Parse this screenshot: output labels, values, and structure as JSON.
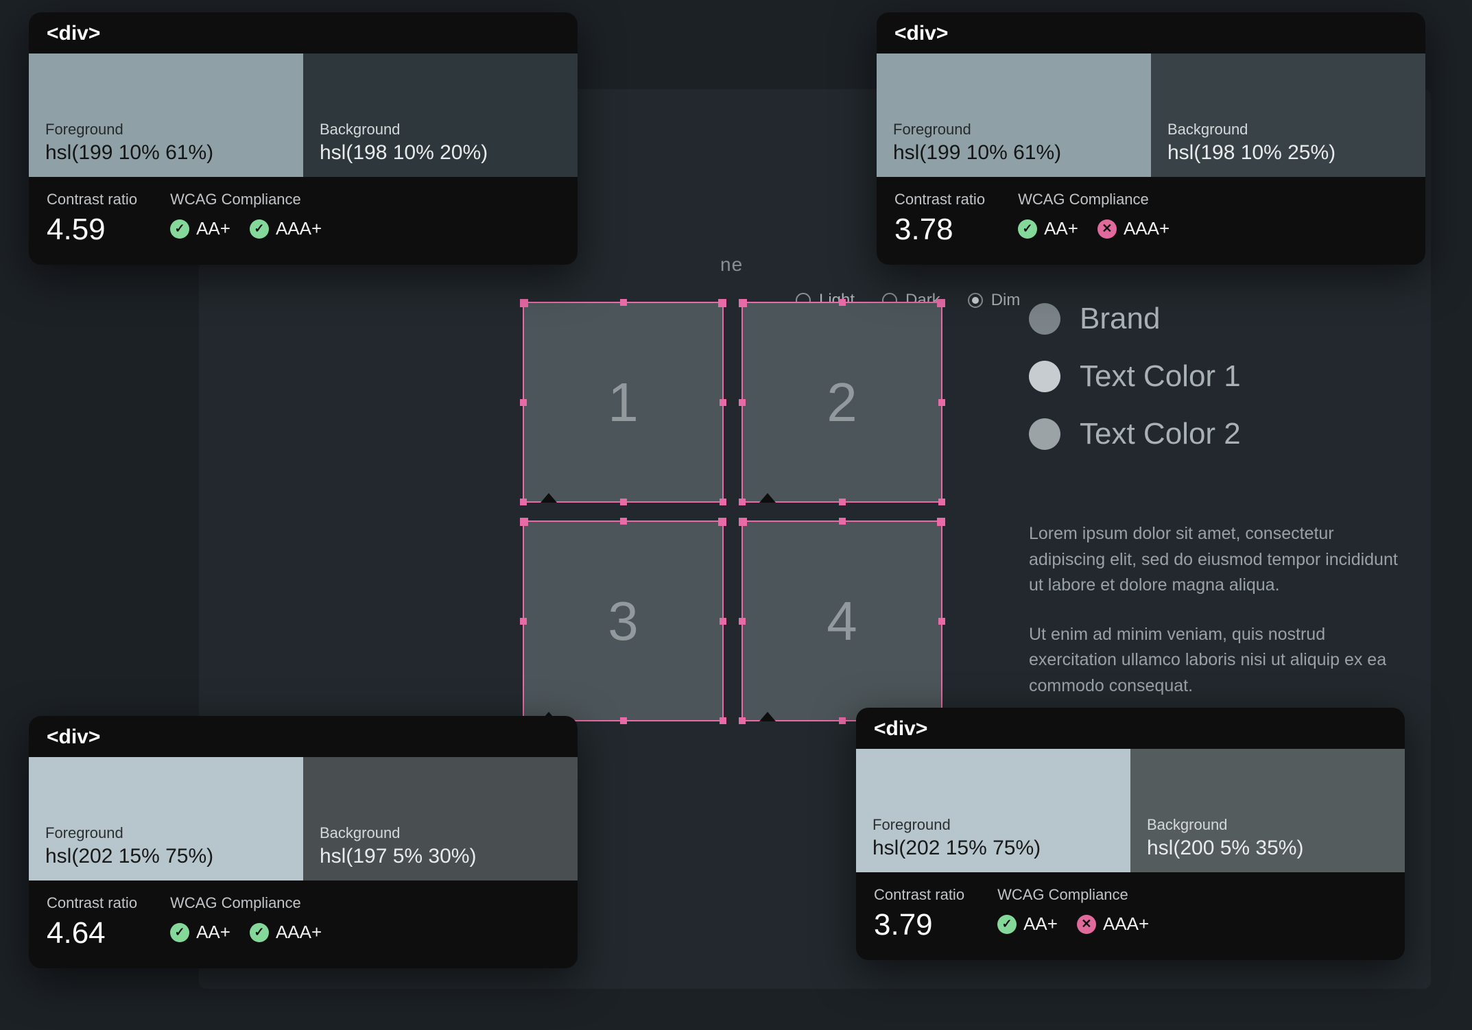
{
  "theme": {
    "title_fragment": "ne",
    "options": [
      "Light",
      "Dark",
      "Dim"
    ],
    "selected": "Dim"
  },
  "grid": {
    "cells": [
      "1",
      "2",
      "3",
      "4"
    ],
    "cell_bg": "#4c5559",
    "selection_color": "#e86aa6"
  },
  "legend": [
    {
      "label": "Brand",
      "color": "#7b8488"
    },
    {
      "label": "Text Color 1",
      "color": "#c6ccd0"
    },
    {
      "label": "Text Color 2",
      "color": "#9ba3a7"
    }
  ],
  "paragraphs": [
    "Lorem ipsum dolor sit amet, consectetur adipiscing elit, sed do eiusmod tempor incididunt ut labore et dolore magna aliqua.",
    "Ut enim ad minim veniam, quis nostrud exercitation ullamco laboris nisi ut aliquip ex ea commodo consequat."
  ],
  "labels": {
    "element_tag": "<div>",
    "foreground": "Foreground",
    "background": "Background",
    "contrast_ratio": "Contrast ratio",
    "wcag": "WCAG Compliance",
    "aa": "AA+",
    "aaa": "AAA+"
  },
  "cards": {
    "tl": {
      "fg_value": "hsl(199 10% 61%)",
      "fg_color": "#8fa0a7",
      "bg_value": "hsl(198 10% 20%)",
      "bg_color": "#2e373b",
      "ratio": "4.59",
      "aa_pass": true,
      "aaa_pass": true
    },
    "tr": {
      "fg_value": "hsl(199 10% 61%)",
      "fg_color": "#8fa0a7",
      "bg_value": "hsl(198 10% 25%)",
      "bg_color": "#394347",
      "ratio": "3.78",
      "aa_pass": true,
      "aaa_pass": false
    },
    "bl": {
      "fg_value": "hsl(202 15% 75%)",
      "fg_color": "#b7c5cc",
      "bg_value": "hsl(197 5% 30%)",
      "bg_color": "#494f51",
      "ratio": "4.64",
      "aa_pass": true,
      "aaa_pass": true
    },
    "br": {
      "fg_value": "hsl(202 15% 75%)",
      "fg_color": "#b7c5cc",
      "bg_value": "hsl(200 5% 35%)",
      "bg_color": "#555c5e",
      "ratio": "3.79",
      "aa_pass": true,
      "aaa_pass": false
    }
  }
}
